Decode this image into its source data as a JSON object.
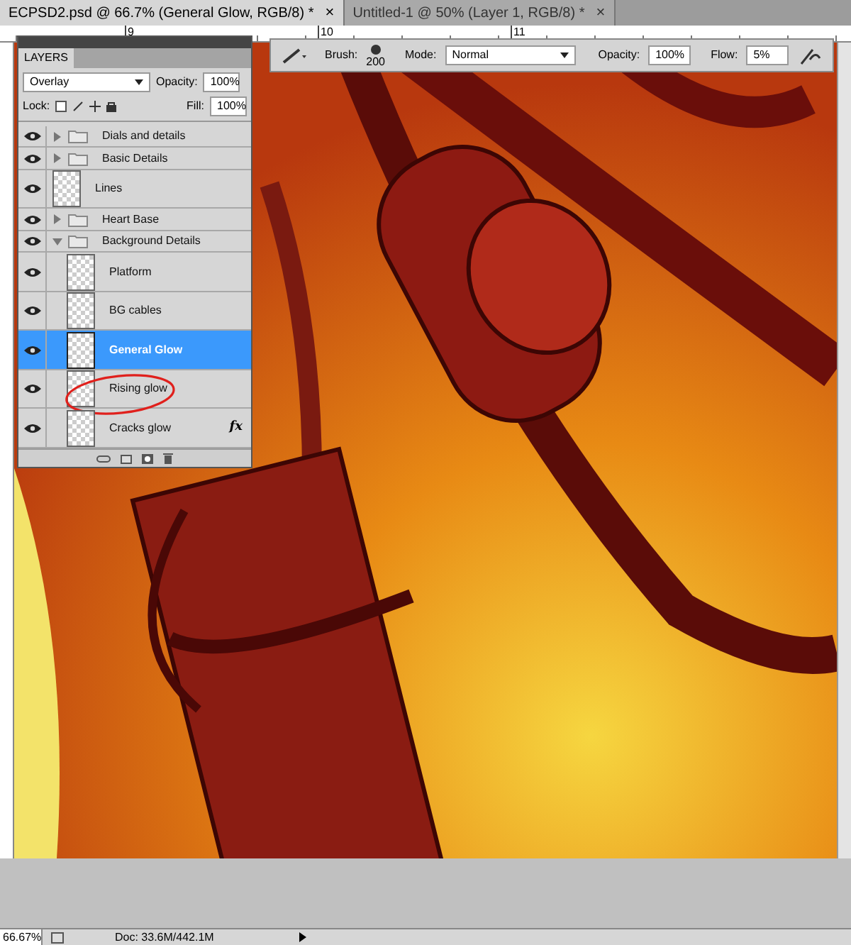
{
  "tabs": [
    {
      "label": "ECPSD2.psd @ 66.7% (General Glow, RGB/8) *",
      "selected": true,
      "close": "×"
    },
    {
      "label": "Untitled-1 @ 50% (Layer 1, RGB/8) *",
      "selected": false,
      "close": "×"
    }
  ],
  "ruler": {
    "labels": [
      "9",
      "10",
      "11"
    ]
  },
  "options_bar": {
    "brush_label": "Brush:",
    "brush_size": "200",
    "mode_label": "Mode:",
    "mode": "Normal",
    "opacity_label": "Opacity:",
    "opacity": "100%",
    "flow_label": "Flow:",
    "flow": "5%"
  },
  "layers_panel": {
    "title": "LAYERS",
    "blend_mode": "Overlay",
    "opacity_label": "Opacity:",
    "opacity": "100%",
    "lock_label": "Lock:",
    "fill_label": "Fill:",
    "fill": "100%",
    "layers": [
      {
        "kind": "group",
        "name": "Dials and details",
        "visible": true,
        "selected": false,
        "expanded": false
      },
      {
        "kind": "group",
        "name": "Basic Details",
        "visible": true,
        "selected": false,
        "expanded": false
      },
      {
        "kind": "layer",
        "name": "Lines",
        "visible": true,
        "selected": false
      },
      {
        "kind": "group",
        "name": "Heart Base",
        "visible": true,
        "selected": false,
        "expanded": false
      },
      {
        "kind": "group",
        "name": "Background Details",
        "visible": true,
        "selected": false,
        "expanded": true,
        "children": [
          {
            "kind": "layer",
            "name": "Platform",
            "visible": true,
            "selected": false
          },
          {
            "kind": "layer",
            "name": "BG cables",
            "visible": true,
            "selected": false
          },
          {
            "kind": "layer",
            "name": "General Glow",
            "visible": true,
            "selected": true
          },
          {
            "kind": "layer",
            "name": "Rising glow",
            "visible": true,
            "selected": false,
            "circled": true
          },
          {
            "kind": "layer",
            "name": "Cracks glow",
            "visible": true,
            "selected": false,
            "effects": "fx"
          }
        ]
      }
    ]
  },
  "status_bar": {
    "zoom": "66.67%",
    "doc": "Doc: 33.6M/442.1M"
  }
}
